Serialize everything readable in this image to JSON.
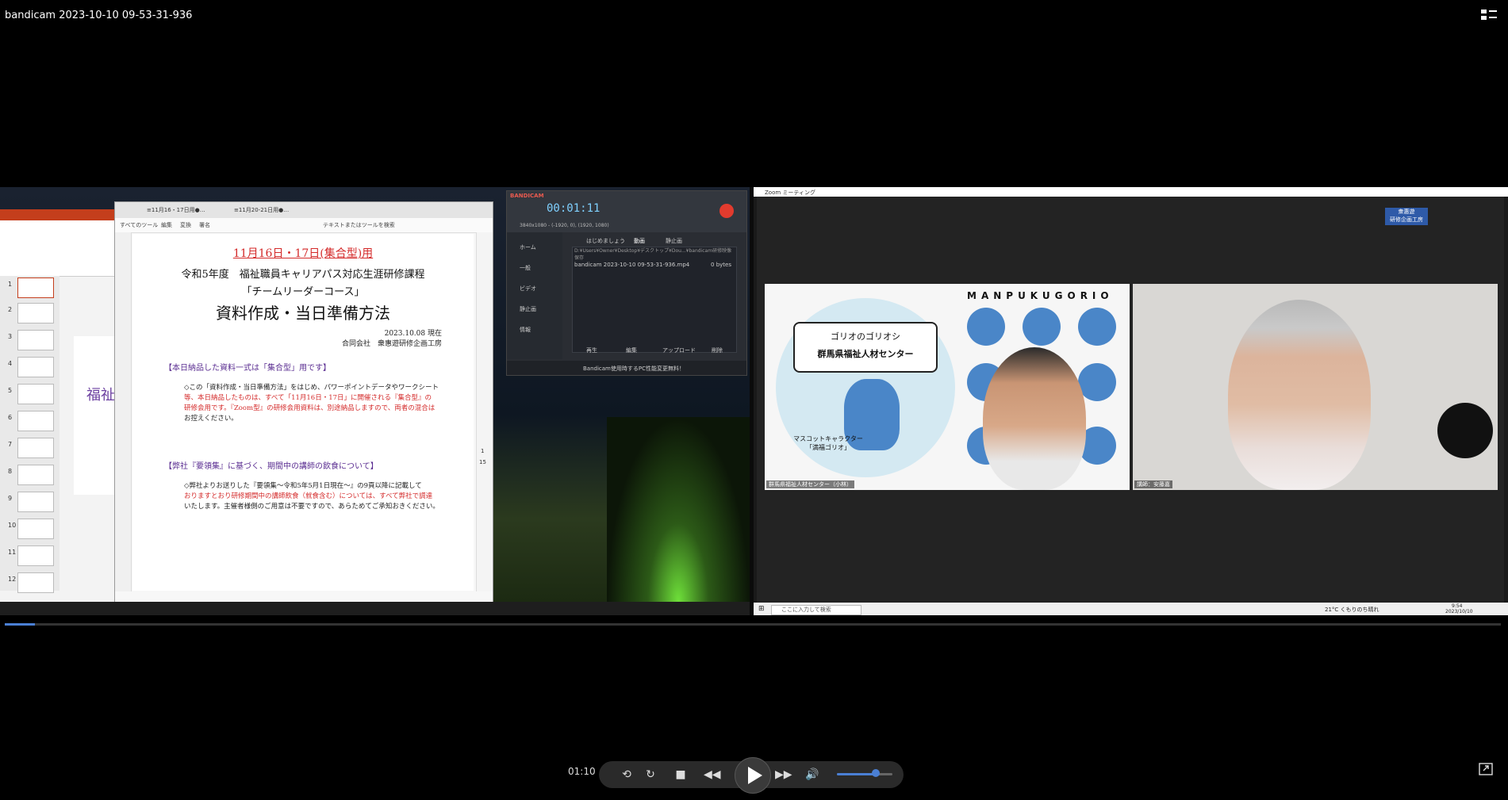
{
  "window": {
    "title": "bandicam 2023-10-10 09-53-31-936"
  },
  "ppt": {
    "thumb_numbers": [
      "1",
      "2",
      "3",
      "4",
      "5",
      "6",
      "7",
      "8",
      "9",
      "10",
      "11",
      "12"
    ],
    "slide_text": "福祉"
  },
  "pdf": {
    "tab1": "≡11月16・17日用●…",
    "tab2": "≡11月20-21日用●…",
    "menu": [
      "すべてのツール",
      "編集",
      "変換",
      "署名"
    ],
    "search": "テキストまたはツールを検索",
    "page": {
      "title": "11月16日・17日(集合型)用",
      "line1": "令和5年度　福祉職員キャリアパス対応生涯研修課程",
      "line2": "「チームリーダーコース」",
      "big": "資料作成・当日準備方法",
      "date": "2023.10.08 現在",
      "company": "合同会社　衆惠遊研修企画工房",
      "head1": "【本日納品した資料一式は「集合型」用です】",
      "para1a": "◇この「資料作成・当日準備方法」をはじめ、パワーポイントデータやワークシート",
      "para1b": "等、本日納品したものは、すべて「11月16日・17日」に開催される『集合型』の",
      "para1c": "研修会用です。『Zoom型』の研修会用資料は、別途納品しますので、両者の混合は",
      "para1d": "お控えください。",
      "head2": "【弊社『要領集』に基づく、期間中の講師の飲食について】",
      "para2a": "◇弊社よりお送りした『要領集～令和5年5月1日現在～』の9頁以降に記載して",
      "para2b": "おりますとおり研修期間中の講師飲食（就食含む）については、すべて弊社で調達",
      "para2c": "いたします。主催者様側のご用意は不要ですので、あらためてご承知おきください。"
    },
    "page_indicator": "1",
    "page_total": "15"
  },
  "bandicam": {
    "brand": "BANDICAM",
    "timer": "00:01:11",
    "resolution": "3840x1080 - (-1920, 0), (1920, 1080)",
    "nav": [
      "ホーム",
      "一般",
      "ビデオ",
      "静止画",
      "情報"
    ],
    "tabs": [
      "はじめましょう",
      "動画",
      "静止画"
    ],
    "path": "D:¥Users¥Owner¥Desktop¥デスクトップ¥Dou...¥bandicam研修映像保存",
    "file": "bandicam 2023-10-10 09-53-31-936.mp4",
    "file_size": "0 bytes",
    "buttons": [
      "再生",
      "編集",
      "アップロード",
      "削除"
    ],
    "footer": "Bandicam使用時するPC性能変更無料！"
  },
  "zoom": {
    "title": "Zoom ミーティング",
    "badge_line1": "衆惠遊",
    "badge_line2": "研修企画工房",
    "manpuku": "MANPUKUGORIO",
    "sign_line1": "ゴリオのゴリオシ",
    "sign_line2": "群馬県福祉人材センター",
    "mascot_caption1": "マスコットキャラクター",
    "mascot_caption2": "「満福ゴリオ」",
    "label1": "群馬県福祉人材センター（小林）",
    "label2": "講師：安藤嘉",
    "search_placeholder": "ここに入力して検索",
    "weather": "21°C くもりのち晴れ",
    "clock_time": "9:54",
    "clock_date": "2023/10/10"
  },
  "player": {
    "time": "01:10",
    "progress": 0.02,
    "volume": 0.7
  }
}
